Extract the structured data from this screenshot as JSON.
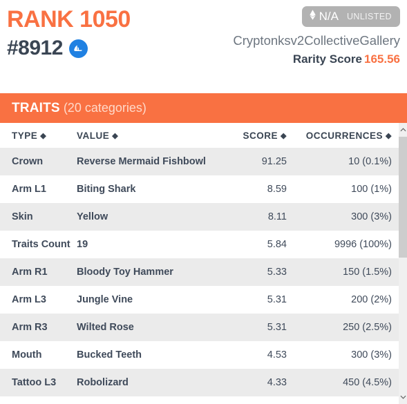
{
  "header": {
    "rank_label": "RANK 1050",
    "token_id": "#8912",
    "opensea_icon": "opensea-sailboat-icon",
    "price": {
      "eth_icon": "ethereum-diamond-icon",
      "value": "N/A",
      "status": "UNLISTED"
    },
    "collection_name": "Cryptonksv2CollectiveGallery",
    "rarity_label": "Rarity Score",
    "rarity_value": "165.56"
  },
  "traits_panel": {
    "title": "TRAITS",
    "count_label": "(20 categories)",
    "columns": [
      {
        "key": "type",
        "label": "TYPE",
        "sort_icon": "sort-updown-icon"
      },
      {
        "key": "value",
        "label": "VALUE",
        "sort_icon": "sort-updown-icon"
      },
      {
        "key": "score",
        "label": "SCORE",
        "sort_icon": "sort-updown-icon"
      },
      {
        "key": "occurrences",
        "label": "OCCURRENCES",
        "sort_icon": "sort-updown-icon"
      }
    ],
    "rows": [
      {
        "type": "Crown",
        "value": "Reverse Mermaid Fishbowl",
        "score": "91.25",
        "occurrences": "10 (0.1%)"
      },
      {
        "type": "Arm L1",
        "value": "Biting Shark",
        "score": "8.59",
        "occurrences": "100 (1%)"
      },
      {
        "type": "Skin",
        "value": "Yellow",
        "score": "8.11",
        "occurrences": "300 (3%)"
      },
      {
        "type": "Traits Count",
        "value": "19",
        "score": "5.84",
        "occurrences": "9996 (100%)"
      },
      {
        "type": "Arm R1",
        "value": "Bloody Toy Hammer",
        "score": "5.33",
        "occurrences": "150 (1.5%)"
      },
      {
        "type": "Arm L3",
        "value": "Jungle Vine",
        "score": "5.31",
        "occurrences": "200 (2%)"
      },
      {
        "type": "Arm R3",
        "value": "Wilted Rose",
        "score": "5.31",
        "occurrences": "250 (2.5%)"
      },
      {
        "type": "Mouth",
        "value": "Bucked Teeth",
        "score": "4.53",
        "occurrences": "300 (3%)"
      },
      {
        "type": "Tattoo L3",
        "value": "Robolizard",
        "score": "4.33",
        "occurrences": "450 (4.5%)"
      }
    ]
  },
  "scrollbar": {
    "up_icon": "chevron-up-icon",
    "down_icon": "chevron-down-icon",
    "thumb": "scrollbar-thumb"
  },
  "colors": {
    "accent_orange": "#f97142",
    "text_dark": "#3a4553",
    "muted_gray": "#6d7680",
    "badge_gray": "#b2b2b2",
    "opensea_blue": "#2081e2",
    "row_alt": "#ebebeb"
  }
}
